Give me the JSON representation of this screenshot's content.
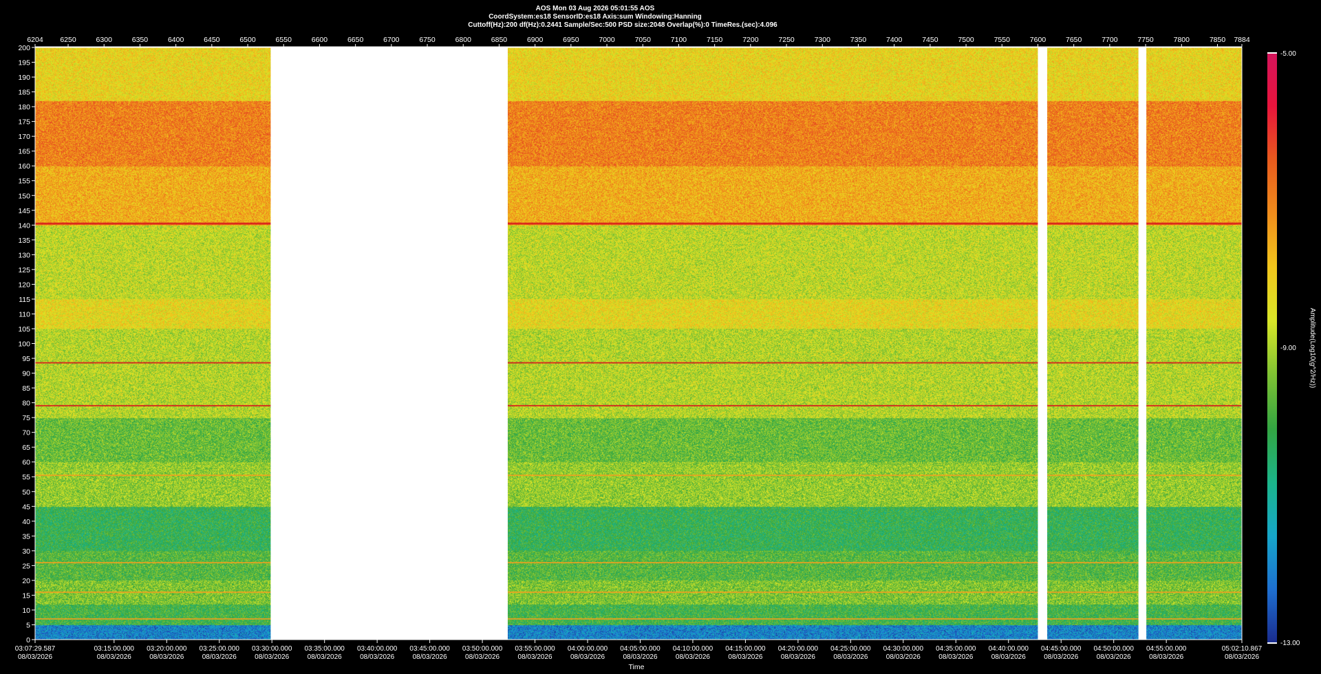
{
  "header": {
    "title": "AOS  Mon 03 Aug 2026 05:01:55  AOS",
    "line2": "CoordSystem:es18   SensorID:es18    Axis:sum    Windowing:Hanning",
    "line3": "Cuttoff(Hz):200      df(Hz):0.2441      Sample/Sec:500      PSD size:2048       Overlap(%):0              TimeRes.(sec):4.096"
  },
  "colorbar": {
    "label": "Amplitude(Log10(g^2/Hz))",
    "max_label": "-5.00",
    "mid_label": "-9.00",
    "min_label": "-13.00",
    "colors": [
      "#1a2a8c",
      "#1e6fd0",
      "#16a6c9",
      "#1bb58a",
      "#33a542",
      "#7fc233",
      "#d8e628",
      "#f2c61c",
      "#f08d1c",
      "#e85a1d",
      "#e8143c",
      "#d4145c"
    ]
  },
  "chart_data": {
    "type": "heatmap",
    "title": "AOS  Mon 03 Aug 2026 05:01:55  AOS",
    "xlabel": "Time",
    "ylabel": "",
    "ylim": [
      0,
      200
    ],
    "top_axis_range": [
      6204,
      7884
    ],
    "top_ticks": [
      "6204",
      "6250",
      "6300",
      "6350",
      "6400",
      "6450",
      "6500",
      "6550",
      "6600",
      "6650",
      "6700",
      "6750",
      "6800",
      "6850",
      "6900",
      "6950",
      "7000",
      "7050",
      "7100",
      "7150",
      "7200",
      "7250",
      "7300",
      "7350",
      "7400",
      "7450",
      "7500",
      "7550",
      "7600",
      "7650",
      "7700",
      "7750",
      "7800",
      "7850",
      "7884"
    ],
    "y_ticks": [
      0,
      5,
      10,
      15,
      20,
      25,
      30,
      35,
      40,
      45,
      50,
      55,
      60,
      65,
      70,
      75,
      80,
      85,
      90,
      95,
      100,
      105,
      110,
      115,
      120,
      125,
      130,
      135,
      140,
      145,
      150,
      155,
      160,
      165,
      170,
      175,
      180,
      185,
      190,
      195,
      200
    ],
    "bottom_ticks": [
      {
        "time": "03:07:29.587",
        "date": "08/03/2026"
      },
      {
        "time": "03:15:00.000",
        "date": "08/03/2026"
      },
      {
        "time": "03:20:00.000",
        "date": "08/03/2026"
      },
      {
        "time": "03:25:00.000",
        "date": "08/03/2026"
      },
      {
        "time": "03:30:00.000",
        "date": "08/03/2026"
      },
      {
        "time": "03:35:00.000",
        "date": "08/03/2026"
      },
      {
        "time": "03:40:00.000",
        "date": "08/03/2026"
      },
      {
        "time": "03:45:00.000",
        "date": "08/03/2026"
      },
      {
        "time": "03:50:00.000",
        "date": "08/03/2026"
      },
      {
        "time": "03:55:00.000",
        "date": "08/03/2026"
      },
      {
        "time": "04:00:00.000",
        "date": "08/03/2026"
      },
      {
        "time": "04:05:00.000",
        "date": "08/03/2026"
      },
      {
        "time": "04:10:00.000",
        "date": "08/03/2026"
      },
      {
        "time": "04:15:00.000",
        "date": "08/03/2026"
      },
      {
        "time": "04:20:00.000",
        "date": "08/03/2026"
      },
      {
        "time": "04:25:00.000",
        "date": "08/03/2026"
      },
      {
        "time": "04:30:00.000",
        "date": "08/03/2026"
      },
      {
        "time": "04:35:00.000",
        "date": "08/03/2026"
      },
      {
        "time": "04:40:00.000",
        "date": "08/03/2026"
      },
      {
        "time": "04:45:00.000",
        "date": "08/03/2026"
      },
      {
        "time": "04:50:00.000",
        "date": "08/03/2026"
      },
      {
        "time": "04:55:00.000",
        "date": "08/03/2026"
      },
      {
        "time": "05:02:10.867",
        "date": "08/03/2026"
      }
    ],
    "data_gaps": [
      [
        6532,
        6862
      ],
      [
        7600,
        7613
      ],
      [
        7740,
        7751
      ]
    ],
    "tones_hz": [
      140.5,
      93.5,
      79,
      55.5,
      26,
      16,
      7
    ],
    "band_levels_hz": [
      {
        "from": 0,
        "to": 5,
        "level": -12.0
      },
      {
        "from": 5,
        "to": 12,
        "level": -10.0
      },
      {
        "from": 12,
        "to": 20,
        "level": -9.4
      },
      {
        "from": 20,
        "to": 30,
        "level": -9.8
      },
      {
        "from": 30,
        "to": 45,
        "level": -10.2
      },
      {
        "from": 45,
        "to": 60,
        "level": -9.2
      },
      {
        "from": 60,
        "to": 75,
        "level": -9.6
      },
      {
        "from": 75,
        "to": 105,
        "level": -8.9
      },
      {
        "from": 105,
        "to": 115,
        "level": -8.3
      },
      {
        "from": 115,
        "to": 140,
        "level": -8.8
      },
      {
        "from": 140,
        "to": 160,
        "level": -7.6
      },
      {
        "from": 160,
        "to": 182,
        "level": -7.0
      },
      {
        "from": 182,
        "to": 200,
        "level": -8.2
      }
    ]
  }
}
